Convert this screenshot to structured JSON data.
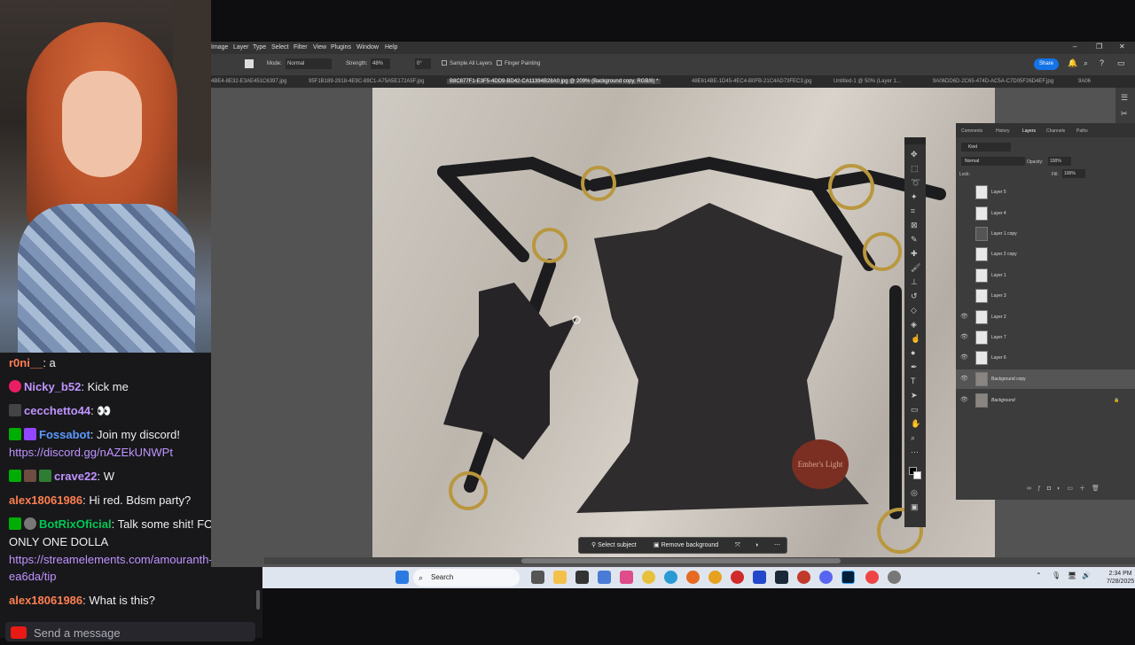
{
  "chat": {
    "messages": [
      {
        "user": "r0ni__",
        "sep": ":",
        "text": " a",
        "user_color": "#ff7f50"
      },
      {
        "user": "Nicky_b52",
        "sep": ":",
        "text": " Kick me",
        "user_color": "#bf94ff"
      },
      {
        "user": "cecchetto44",
        "sep": ":",
        "text": " 👀",
        "user_color": "#bf94ff"
      },
      {
        "user": "Fossabot",
        "sep": ":",
        "text": " Join my discord!",
        "user_color": "#5b99ff"
      },
      {
        "link": "https://discord.gg/nAZEkUNWPt"
      },
      {
        "user": "crave22",
        "sep": ":",
        "text": " W",
        "user_color": "#bf94ff"
      },
      {
        "user": "alex18061986",
        "sep": ":",
        "text": " Hi red. Bdsm party?",
        "user_color": "#ff7f50"
      },
      {
        "user": "BotRixOficial",
        "sep": ":",
        "text": " Talk some shit! FOR",
        "user_color": "#00c853"
      },
      {
        "text_cont": "ONLY ONE DOLLA"
      },
      {
        "link": "https://streamelements.com/amouranth-"
      },
      {
        "link": "ea6da/tip"
      },
      {
        "user": "alex18061986",
        "sep": ":",
        "text": " What is this?",
        "user_color": "#ff7f50"
      }
    ],
    "input_placeholder": "Send a message"
  },
  "photoshop": {
    "menu": [
      "Image",
      "Layer",
      "Type",
      "Select",
      "Filter",
      "View",
      "Plugins",
      "Window",
      "Help"
    ],
    "options": {
      "mode_label": "Mode:",
      "mode_value": "Normal",
      "strength_label": "Strength:",
      "strength_value": "48%",
      "angle_value": "0°",
      "sample_all": "Sample All Layers",
      "finger_painting": "Finger Painting",
      "share": "Share"
    },
    "tabs": [
      "4BE4-8E32-E3AE451C6397.jpg",
      "95F1B189-2918-4E9C-89C1-A75A5E172A5F.jpg",
      "B8C877F1-E3F5-4DD9-BD42-CA11394B28A0.jpg @ 209% (Background copy, RGB/8) *",
      "48E614BE-1D45-4EC4-B0FB-21C4AD73FEC3.jpg",
      "Untitled-1 @ 50% (Layer 1...",
      "9A06DD6D-2C65-474D-AC5A-C7D05F26D4EF.jpg",
      "9A06"
    ],
    "panel_tabs": [
      "Comments",
      "History",
      "Layers",
      "Channels",
      "Paths"
    ],
    "kind_label": "Kind",
    "blend_mode": "Normal",
    "opacity_label": "Opacity:",
    "opacity_value": "100%",
    "lock_label": "Lock:",
    "fill_label": "Fill:",
    "fill_value": "100%",
    "layers": [
      {
        "name": "Layer 5",
        "visible": false
      },
      {
        "name": "Layer 4",
        "visible": false
      },
      {
        "name": "Layer 1 copy",
        "visible": false
      },
      {
        "name": "Layer 2 copy",
        "visible": false
      },
      {
        "name": "Layer 1",
        "visible": false
      },
      {
        "name": "Layer 3",
        "visible": false
      },
      {
        "name": "Layer 2",
        "visible": true
      },
      {
        "name": "Layer 7",
        "visible": true
      },
      {
        "name": "Layer 6",
        "visible": true
      },
      {
        "name": "Background copy",
        "visible": true,
        "selected": true
      },
      {
        "name": "Background",
        "visible": true,
        "locked": true
      }
    ],
    "context_bar": {
      "select_subject": "Select subject",
      "remove_background": "Remove background"
    },
    "tag_text": "Ember's Light"
  },
  "taskbar": {
    "search_label": "Search",
    "time": "2:34 PM",
    "date": "7/28/2025"
  },
  "colors": {
    "chat_bg": "#18181b",
    "ps_bg": "#535353",
    "ps_panel": "#3c3c3c",
    "share_blue": "#1473e6"
  }
}
